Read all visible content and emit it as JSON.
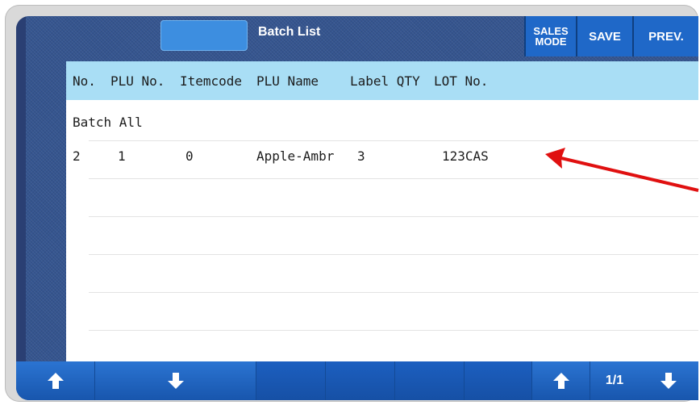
{
  "header": {
    "title": "Batch List",
    "sales_mode_line1": "SALES",
    "sales_mode_line2": "MODE",
    "save_label": "SAVE",
    "prev_label": "PREV."
  },
  "table": {
    "columns": [
      "No.",
      "PLU No.",
      "Itemcode",
      "PLU Name",
      "Label QTY",
      "LOT No."
    ],
    "batch_all_label": "Batch All",
    "rows": [
      {
        "no": "2",
        "plu_no": "1",
        "itemcode": "0",
        "plu_name": "Apple-Ambr",
        "label_qty": "3",
        "lot_no": "123CAS"
      }
    ]
  },
  "footer": {
    "page_indicator": "1/1"
  },
  "colors": {
    "header_bg": "#35558f",
    "button_blue": "#1f68c8",
    "column_header_bg": "#a9def5",
    "annotation_arrow": "#e01010"
  },
  "icons": [
    "up-arrow-icon",
    "down-arrow-icon"
  ]
}
